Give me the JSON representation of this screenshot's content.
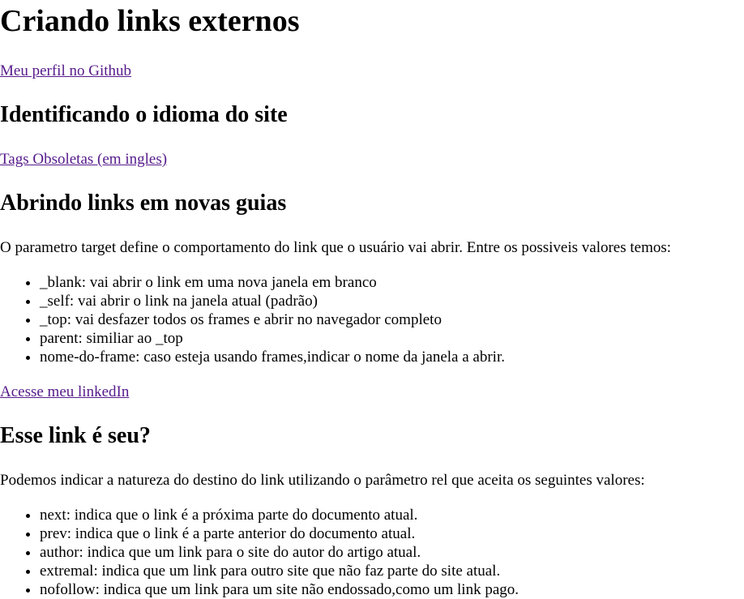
{
  "title": "Criando links externos",
  "links": {
    "github": "Meu perfil no Github",
    "tags_obsoletas": "Tags Obsoletas (em ingles)",
    "linkedin": "Acesse meu linkedIn"
  },
  "sections": {
    "idioma": {
      "heading": "Identificando o idioma do site"
    },
    "novas_guias": {
      "heading": "Abrindo links em novas guias",
      "paragraph": "O parametro target define o comportamento do link que o usuário vai abrir. Entre os possiveis valores temos:",
      "items": [
        "_blank: vai abrir o link em uma nova janela em branco",
        "_self: vai abrir o link na janela atual (padrão)",
        "_top: vai desfazer todos os frames e abrir no navegador completo",
        "parent: similiar ao _top",
        "nome-do-frame: caso esteja usando frames,indicar o nome da janela a abrir."
      ]
    },
    "link_seu": {
      "heading": "Esse link é seu?",
      "paragraph": "Podemos indicar a natureza do destino do link utilizando o parâmetro rel que aceita os seguintes valores:",
      "items": [
        "next: indica que o link é a próxima parte do documento atual.",
        "prev: indica que o link é a parte anterior do documento atual.",
        "author: indica que um link para o site do autor do artigo atual.",
        "extremal: indica que um link para outro site que não faz parte do site atual.",
        "nofollow: indica que um link para um site não endossado,como um link pago."
      ]
    }
  },
  "colors": {
    "visited_link": "#551a8b",
    "text": "#000000",
    "background": "#ffffff"
  }
}
